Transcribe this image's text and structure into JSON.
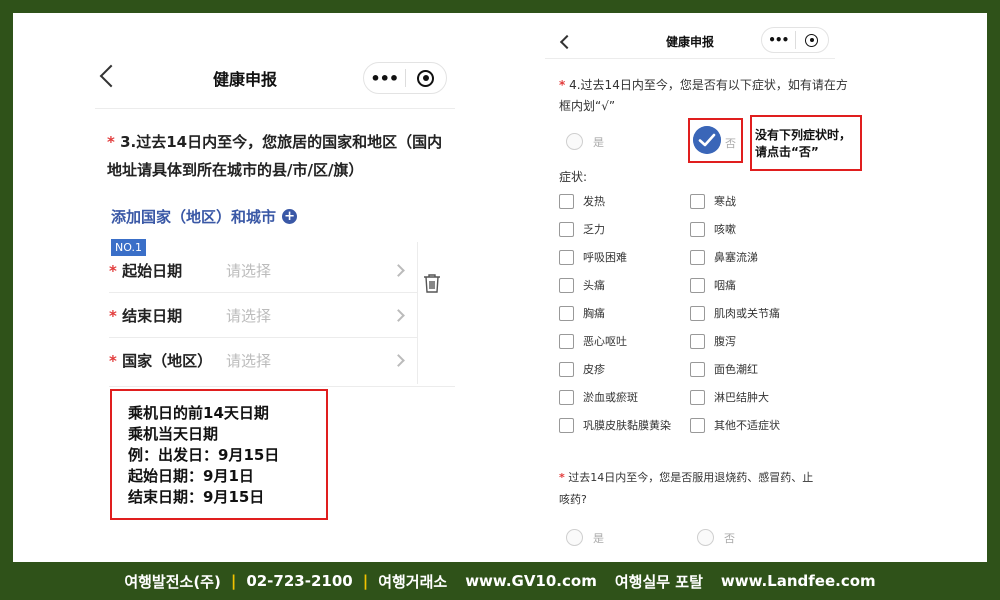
{
  "left": {
    "nav_title": "健康申报",
    "capsule_more": "•••",
    "question_req": "*",
    "question_text": "3.过去14日内至今，您旅居的国家和地区（国内地址请具体到所在城市的县/市/区/旗）",
    "add_link": "添加国家（地区）和城市",
    "add_icon": "+",
    "badge": "NO.1",
    "rows": [
      {
        "req": "*",
        "label": "起始日期",
        "placeholder": "请选择"
      },
      {
        "req": "*",
        "label": "结束日期",
        "placeholder": "请选择"
      },
      {
        "req": "*",
        "label": "国家（地区）",
        "placeholder": "请选择"
      }
    ],
    "note_lines": [
      "乘机日的前14天日期",
      "乘机当天日期",
      "例：出发日：9月15日",
      "起始日期：9月1日",
      "结束日期：9月15日"
    ]
  },
  "right": {
    "nav_title": "健康申报",
    "capsule_more": "•••",
    "question_req": "*",
    "question_text": "4.过去14日内至今，您是否有以下症状，如有请在方框内划“√”",
    "yes": "是",
    "no": "否",
    "note_lines": [
      "没有下列症状时，",
      "请点击“否”"
    ],
    "symptoms_label": "症状:",
    "symptoms_left": [
      "发热",
      "乏力",
      "呼吸困难",
      "头痛",
      "胸痛",
      "恶心呕吐",
      "皮疹",
      "淤血或瘀斑",
      "巩膜皮肤黏膜黄染"
    ],
    "symptoms_right": [
      "寒战",
      "咳嗽",
      "鼻塞流涕",
      "咽痛",
      "肌肉或关节痛",
      "腹泻",
      "面色潮红",
      "淋巴结肿大",
      "其他不适症状"
    ],
    "question2_req": "*",
    "question2_text": "过去14日内至今，您是否服用退烧药、感冒药、止咳药?",
    "yes2": "是",
    "no2": "否"
  },
  "footer": {
    "company": "여행발전소(주)",
    "sep1": "|",
    "phone": "02-723-2100",
    "sep2": "|",
    "market": "여행거래소",
    "url1": "www.GV10.com",
    "portal": "여행실무 포탈",
    "url2": "www.Landfee.com"
  },
  "colors": {
    "background": "#2f5219",
    "accent": "#3a58a6",
    "highlight_box": "#e01e1e",
    "required": "#e23b3b",
    "separator": "#f2c200"
  }
}
